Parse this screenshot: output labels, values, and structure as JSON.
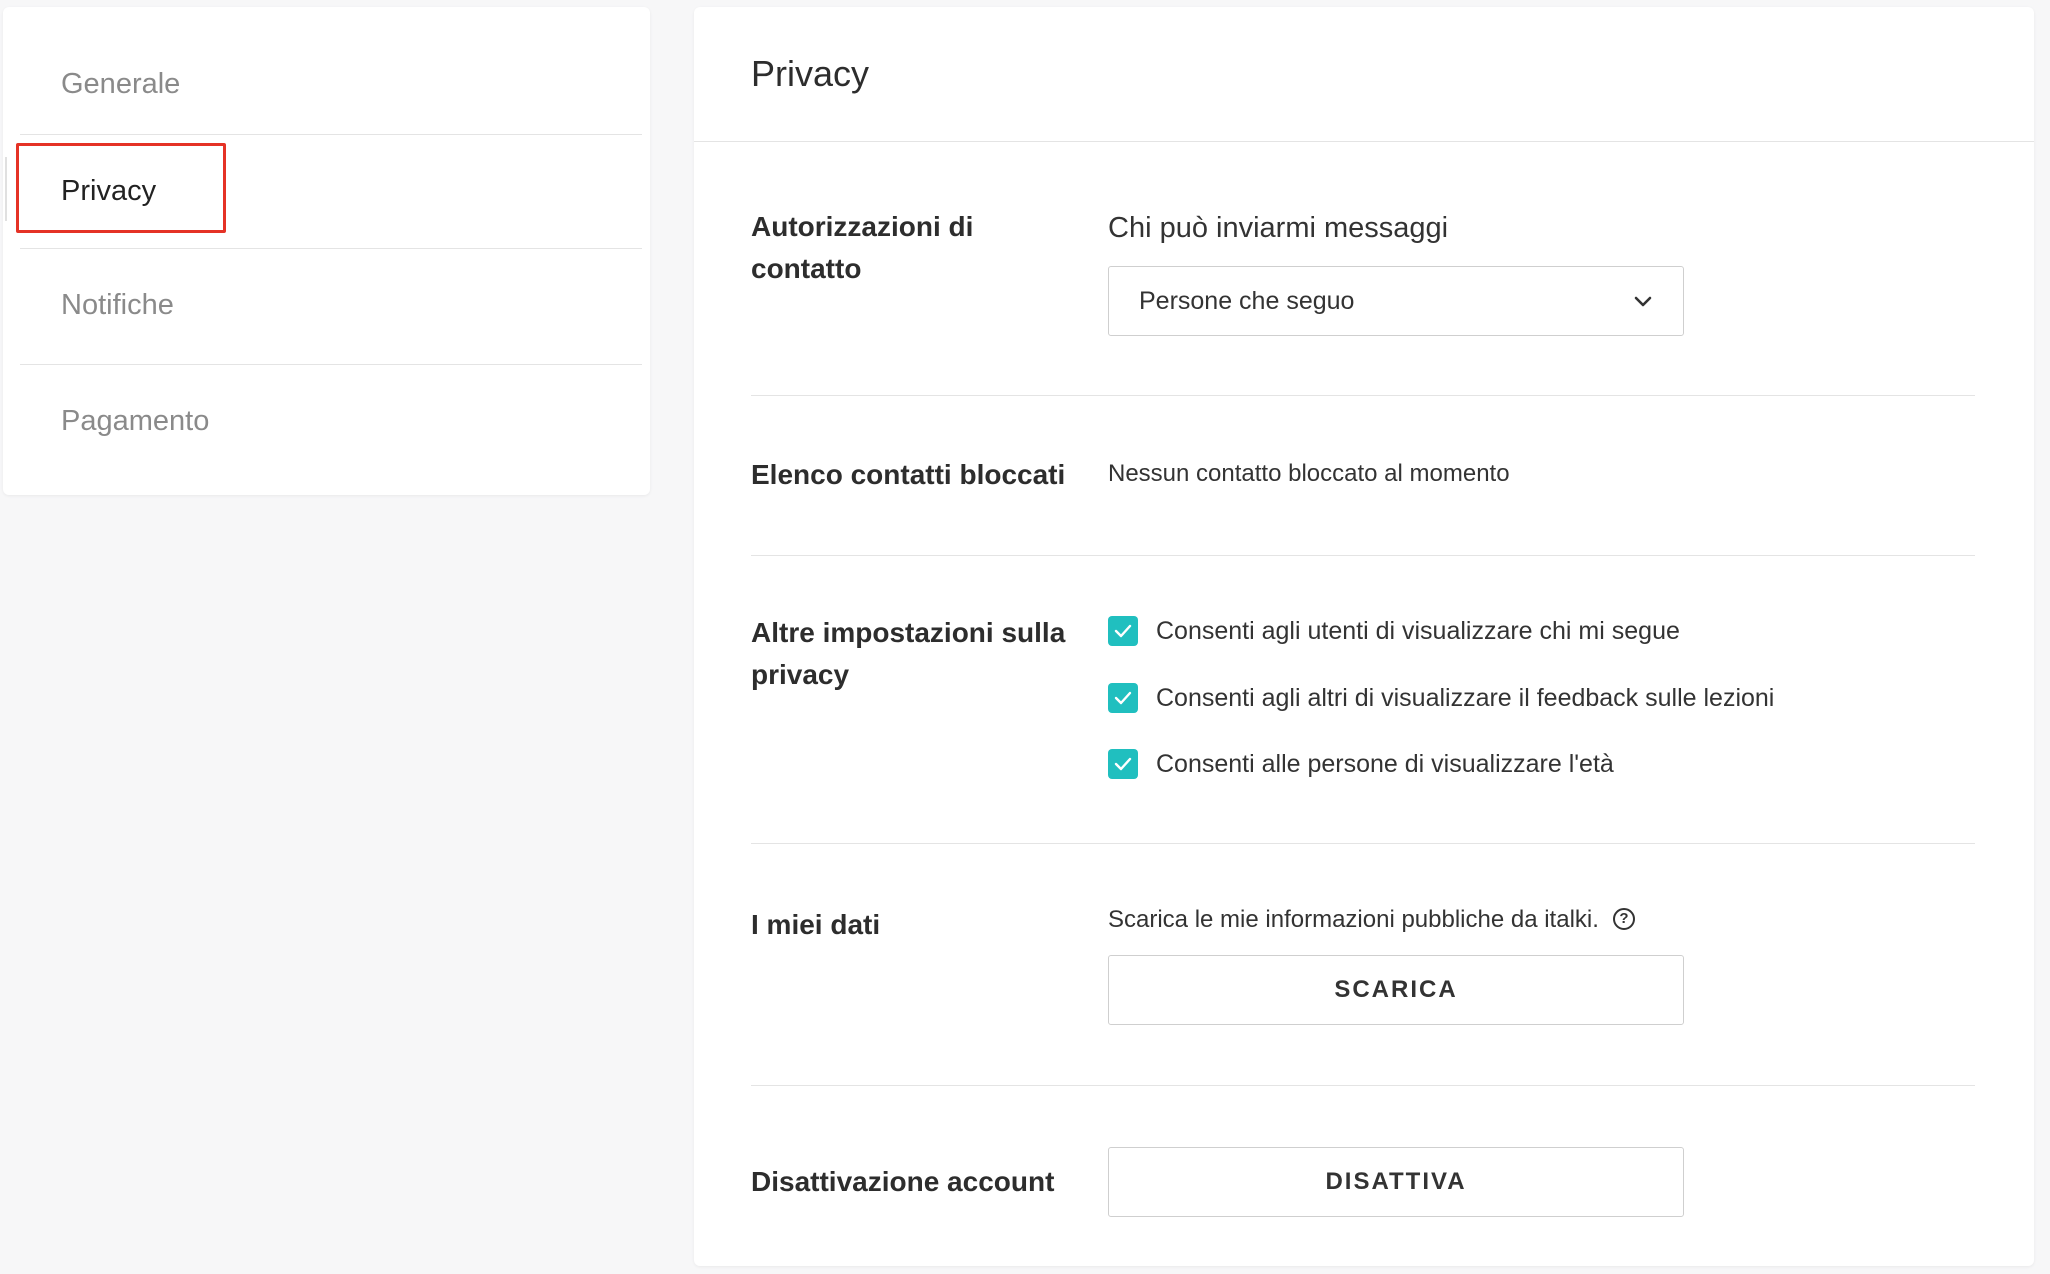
{
  "sidebar": {
    "items": [
      {
        "label": "Generale"
      },
      {
        "label": "Privacy"
      },
      {
        "label": "Notifiche"
      },
      {
        "label": "Pagamento"
      }
    ]
  },
  "main": {
    "title": "Privacy",
    "contact": {
      "label": "Autorizzazioni di contatto",
      "field_label": "Chi può inviarmi messaggi",
      "select_value": "Persone che seguo"
    },
    "blocked": {
      "label": "Elenco contatti bloccati",
      "text": "Nessun contatto bloccato al momento"
    },
    "other": {
      "label": "Altre impostazioni sulla privacy",
      "options": [
        {
          "label": "Consenti agli utenti di visualizzare chi mi segue",
          "checked": true
        },
        {
          "label": "Consenti agli altri di visualizzare il feedback sulle lezioni",
          "checked": true
        },
        {
          "label": "Consenti alle persone di visualizzare l'età",
          "checked": true
        }
      ]
    },
    "data": {
      "label": "I miei dati",
      "text": "Scarica le mie informazioni pubbliche da italki.",
      "help_glyph": "?",
      "button": "SCARICA"
    },
    "deactivate": {
      "label": "Disattivazione account",
      "button": "DISATTIVA"
    }
  },
  "colors": {
    "accent": "#20bfbf",
    "highlight": "#e53226"
  }
}
